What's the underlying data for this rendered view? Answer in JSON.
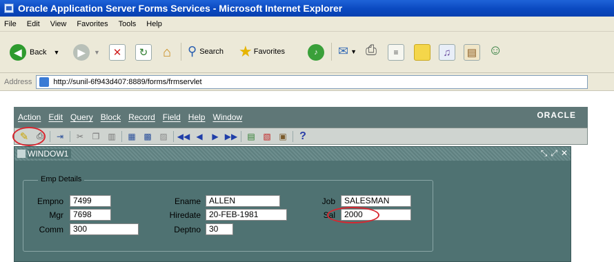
{
  "ie": {
    "title": "Oracle Application Server Forms Services - Microsoft Internet Explorer",
    "menu": [
      "File",
      "Edit",
      "View",
      "Favorites",
      "Tools",
      "Help"
    ],
    "toolbar": {
      "back_label": "Back",
      "search_label": "Search",
      "favorites_label": "Favorites"
    },
    "address_label": "Address",
    "url": "http://sunil-6f943d407:8889/forms/frmservlet"
  },
  "forms": {
    "menu": [
      "Action",
      "Edit",
      "Query",
      "Block",
      "Record",
      "Field",
      "Help",
      "Window"
    ],
    "logo": "ORACLE",
    "help_glyph": "?"
  },
  "window": {
    "title": "WINDOW1",
    "frame_title": "Emp Details",
    "fields": {
      "empno": {
        "label": "Empno",
        "value": "7499"
      },
      "mgr": {
        "label": "Mgr",
        "value": "7698"
      },
      "comm": {
        "label": "Comm",
        "value": "300"
      },
      "ename": {
        "label": "Ename",
        "value": "ALLEN"
      },
      "hiredate": {
        "label": "Hiredate",
        "value": "20-FEB-1981"
      },
      "deptno": {
        "label": "Deptno",
        "value": "30"
      },
      "job": {
        "label": "Job",
        "value": "SALESMAN"
      },
      "sal": {
        "label": "Sal",
        "value": "2000"
      }
    }
  }
}
